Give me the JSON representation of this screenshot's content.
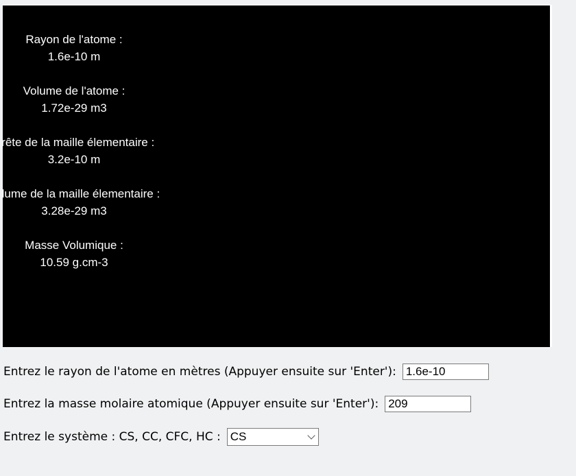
{
  "canvas": {
    "stats": [
      {
        "label": "Rayon de l'atome :",
        "value": "1.6e-10 m"
      },
      {
        "label": "Volume de l'atome :",
        "value": "1.72e-29 m3"
      },
      {
        "label": "Arête de la maille élementaire :",
        "value": "3.2e-10 m"
      },
      {
        "label": "Volume de la maille élementaire :",
        "value": "3.28e-29 m3"
      },
      {
        "label": "Masse Volumique :",
        "value": "10.59 g.cm-3"
      }
    ]
  },
  "form": {
    "radius": {
      "label": "Entrez le rayon de l'atome en mètres (Appuyer ensuite sur 'Enter'):",
      "value": "1.6e-10"
    },
    "molar_mass": {
      "label": "Entrez la masse molaire atomique (Appuyer ensuite sur 'Enter'):",
      "value": "209"
    },
    "system": {
      "label": "Entrez le système : CS, CC, CFC, HC :",
      "selected": "CS",
      "icon": "chevron-down-icon"
    }
  },
  "colors": {
    "page_background": "#f0f1f2",
    "canvas_background": "#000000",
    "canvas_text": "#ffffff"
  }
}
